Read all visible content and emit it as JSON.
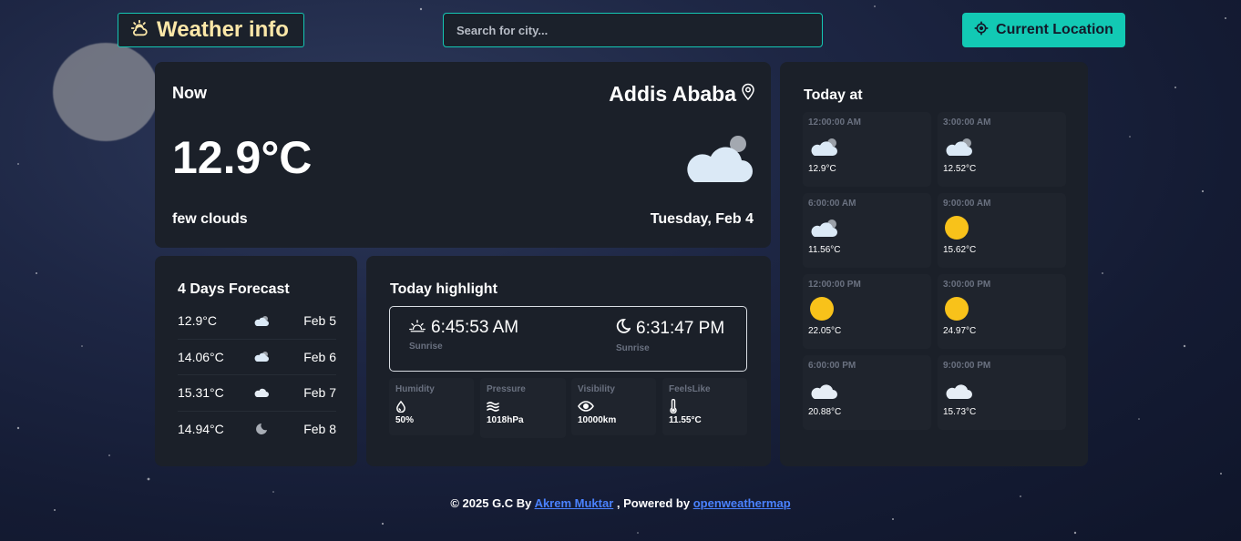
{
  "header": {
    "logo_text": "Weather info",
    "logo_icon": "sun-cloud-icon",
    "search_placeholder": "Search for city...",
    "location_button_label": "Current Location",
    "location_icon": "crosshair-icon"
  },
  "now": {
    "label": "Now",
    "city": "Addis Ababa",
    "city_icon": "map-pin-icon",
    "temperature": "12.9°C",
    "description": "few clouds",
    "date": "Tuesday, Feb 4",
    "icon": "cloud-moon-icon"
  },
  "forecast": {
    "title": "4 Days Forecast",
    "days": [
      {
        "temp": "12.9°C",
        "icon": "cloud-moon-icon",
        "date": "Feb 5"
      },
      {
        "temp": "14.06°C",
        "icon": "cloud-moon-icon",
        "date": "Feb 6"
      },
      {
        "temp": "15.31°C",
        "icon": "cloud-icon",
        "date": "Feb 7"
      },
      {
        "temp": "14.94°C",
        "icon": "moon-icon",
        "date": "Feb 8"
      }
    ]
  },
  "highlight": {
    "title": "Today highlight",
    "sunrise": {
      "time": "6:45:53 AM",
      "label": "Sunrise",
      "icon": "sunrise-icon"
    },
    "sunset": {
      "time": "6:31:47 PM",
      "label": "Sunrise",
      "icon": "moon-icon"
    },
    "stats": [
      {
        "label": "Humidity",
        "value": "50%",
        "icon": "droplet-icon"
      },
      {
        "label": "Pressure",
        "value": "1018hPa",
        "icon": "wind-waves-icon"
      },
      {
        "label": "Visibility",
        "value": "10000km",
        "icon": "eye-icon"
      },
      {
        "label": "FeelsLike",
        "value": "11.55°C",
        "icon": "thermometer-icon"
      }
    ]
  },
  "today": {
    "title": "Today at",
    "hours": [
      {
        "time": "12:00:00 AM",
        "temp": "12.9°C",
        "icon": "cloud-moon-icon"
      },
      {
        "time": "3:00:00 AM",
        "temp": "12.52°C",
        "icon": "cloud-moon-icon"
      },
      {
        "time": "6:00:00 AM",
        "temp": "11.56°C",
        "icon": "cloud-moon-icon"
      },
      {
        "time": "9:00:00 AM",
        "temp": "15.62°C",
        "icon": "sun-icon"
      },
      {
        "time": "12:00:00 PM",
        "temp": "22.05°C",
        "icon": "sun-icon"
      },
      {
        "time": "3:00:00 PM",
        "temp": "24.97°C",
        "icon": "sun-icon"
      },
      {
        "time": "6:00:00 PM",
        "temp": "20.88°C",
        "icon": "cloud-icon"
      },
      {
        "time": "9:00:00 PM",
        "temp": "15.73°C",
        "icon": "cloud-icon"
      }
    ]
  },
  "footer": {
    "prefix": "© 2025 G.C By",
    "author": "Akrem Muktar",
    "middle": ", Powered by",
    "provider": "openweathermap"
  },
  "colors": {
    "accent": "#12c9b4",
    "card": "#1b2029",
    "sun": "#f8c21a",
    "link": "#4a82ff"
  }
}
